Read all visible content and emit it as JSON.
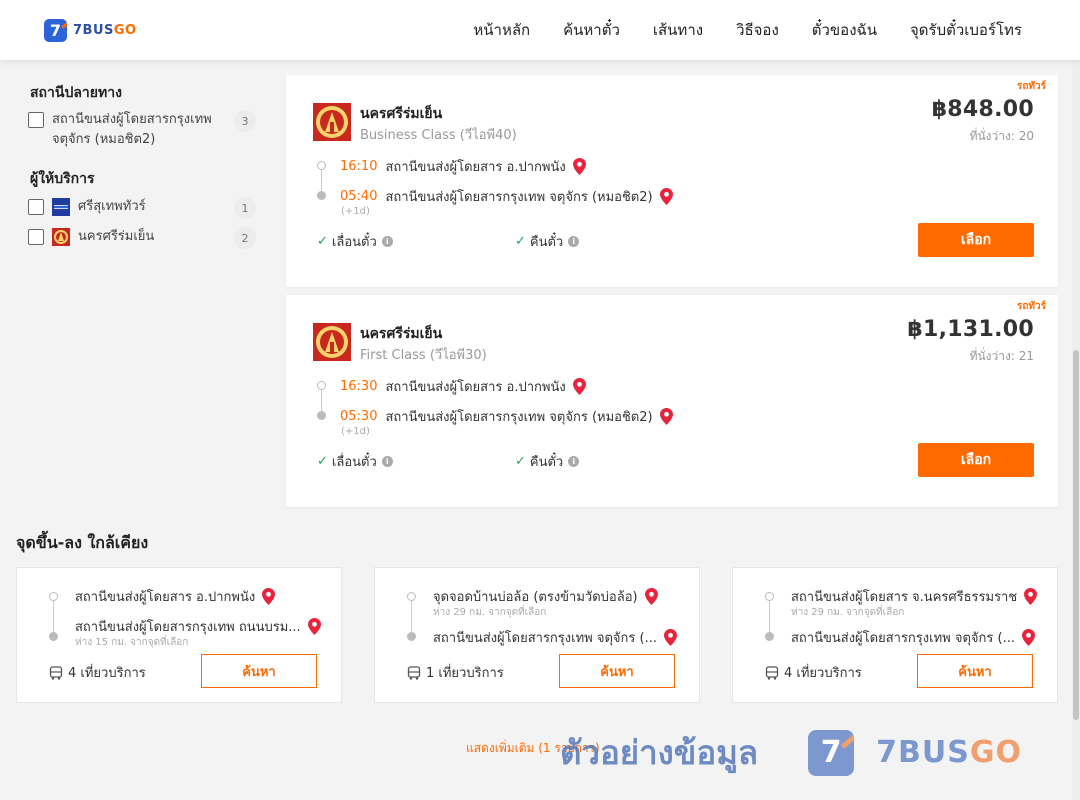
{
  "header": {
    "logo_num": "7",
    "logo_a": "7BUS",
    "logo_b": "GO",
    "nav": [
      "หน้าหลัก",
      "ค้นหาตั๋ว",
      "เส้นทาง",
      "วิธีจอง",
      "ตั๋วของฉัน",
      "จุดรับตั๋วเบอร์โทร"
    ]
  },
  "filters": {
    "destination_title": "สถานีปลายทาง",
    "destination_items": [
      {
        "label": "สถานีขนส่งผู้โดยสารกรุงเทพ จตุจักร (หมอชิต2)",
        "count": "3"
      }
    ],
    "operator_title": "ผู้ให้บริการ",
    "operator_items": [
      {
        "label": "ศรีสุเทพทัวร์",
        "count": "1"
      },
      {
        "label": "นครศรีร่มเย็น",
        "count": "2"
      }
    ]
  },
  "trips": [
    {
      "type": "รถทัวร์",
      "operator": "นครศรีร่มเย็น",
      "class": "Business Class (วีไอพี40)",
      "price": "฿848.00",
      "seats": "ที่นั่งว่าง: 20",
      "depart_time": "16:10",
      "depart_station": "สถานีขนส่งผู้โดยสาร อ.ปากพนัง",
      "arrive_time": "05:40",
      "arrive_station": "สถานีขนส่งผู้โดยสารกรุงเทพ จตุจักร (หมอชิต2)",
      "plus_day": "(+1d)",
      "policy_1": "เลื่อนตั๋ว",
      "policy_2": "คืนตั๋ว",
      "select_label": "เลือก"
    },
    {
      "type": "รถทัวร์",
      "operator": "นครศรีร่มเย็น",
      "class": "First Class (วีไอพี30)",
      "price": "฿1,131.00",
      "seats": "ที่นั่งว่าง: 21",
      "depart_time": "16:30",
      "depart_station": "สถานีขนส่งผู้โดยสาร อ.ปากพนัง",
      "arrive_time": "05:30",
      "arrive_station": "สถานีขนส่งผู้โดยสารกรุงเทพ จตุจักร (หมอชิต2)",
      "plus_day": "(+1d)",
      "policy_1": "เลื่อนตั๋ว",
      "policy_2": "คืนตั๋ว",
      "select_label": "เลือก"
    }
  ],
  "nearby": {
    "title": "จุดขึ้น-ลง ใกล้เคียง",
    "cards": [
      {
        "from": "สถานีขนส่งผู้โดยสาร อ.ปากพนัง",
        "from_dist": "",
        "to": "สถานีขนส่งผู้โดยสารกรุงเทพ ถนนบรม...",
        "to_dist": "ห่าง 15 กม. จากจุดที่เลือก",
        "trips": "4 เที่ยวบริการ",
        "search_label": "ค้นหา"
      },
      {
        "from": "จุดจอดบ้านบ่อล้อ (ตรงข้ามวัดบ่อล้อ)",
        "from_dist": "ห่าง 29 กม. จากจุดที่เลือก",
        "to": "สถานีขนส่งผู้โดยสารกรุงเทพ จตุจักร (...",
        "to_dist": "",
        "trips": "1 เที่ยวบริการ",
        "search_label": "ค้นหา"
      },
      {
        "from": "สถานีขนส่งผู้โดยสาร จ.นครศรีธรรมราช",
        "from_dist": "ห่าง 29 กม. จากจุดที่เลือก",
        "to": "สถานีขนส่งผู้โดยสารกรุงเทพ จตุจักร (...",
        "to_dist": "",
        "trips": "4 เที่ยวบริการ",
        "search_label": "ค้นหา"
      }
    ],
    "show_more": "แสดงเพิ่มเติม (1 รายการ)"
  },
  "watermark": {
    "text": "ตัวอย่างข้อมูล",
    "mark": "7",
    "brand_a": "7BUS",
    "brand_b": "GO"
  },
  "colors": {
    "accent": "#ff6a00",
    "brand_blue": "#2d63d9",
    "available_check": "#1aa55a"
  }
}
